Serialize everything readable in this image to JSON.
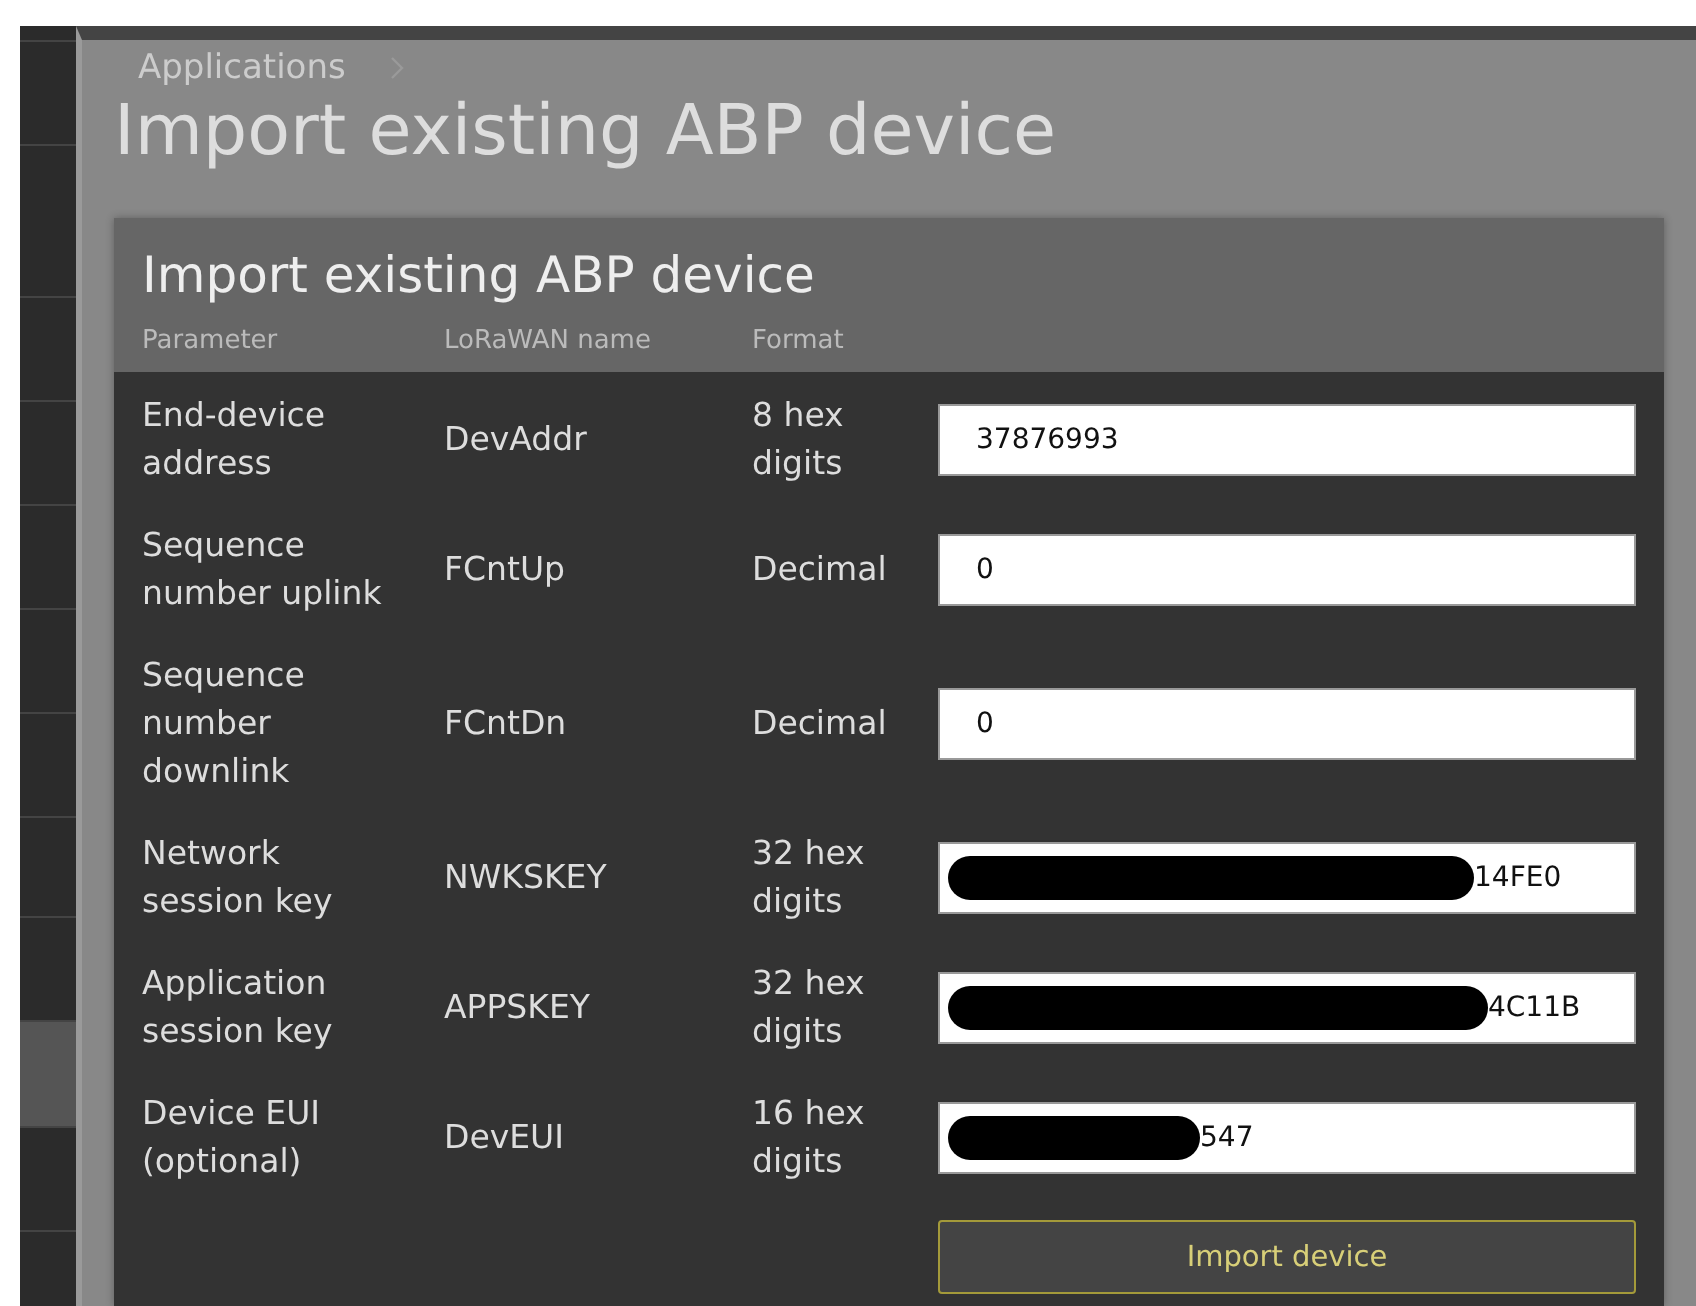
{
  "sidebar": {
    "items": [
      {
        "selected": false
      },
      {
        "selected": false
      },
      {
        "selected": false
      },
      {
        "selected": false
      },
      {
        "selected": false
      },
      {
        "selected": false
      },
      {
        "selected": false
      },
      {
        "selected": false
      },
      {
        "selected": false
      },
      {
        "selected": true
      },
      {
        "selected": false
      },
      {
        "selected": false
      }
    ]
  },
  "breadcrumb": [
    "Applications"
  ],
  "page_title": "Import existing ABP device",
  "card": {
    "title": "Import existing ABP device",
    "columns": [
      "Parameter",
      "LoRaWAN name",
      "Format"
    ],
    "rows": [
      {
        "parameter": "End-device address",
        "name": "DevAddr",
        "format": "8 hex digits",
        "value": "37876993",
        "redacted": false
      },
      {
        "parameter": "Sequence number uplink",
        "name": "FCntUp",
        "format": "Decimal",
        "value": "0",
        "redacted": false
      },
      {
        "parameter": "Sequence number downlink",
        "name": "FCntDn",
        "format": "Decimal",
        "value": "0",
        "redacted": false
      },
      {
        "parameter": "Network session key",
        "name": "NWKSKEY",
        "format": "32 hex digits",
        "value": "14FE0",
        "redacted": true
      },
      {
        "parameter": "Application session key",
        "name": "APPSKEY",
        "format": "32 hex digits",
        "value": "4C11B",
        "redacted": true
      },
      {
        "parameter": "Device EUI (optional)",
        "name": "DevEUI",
        "format": "16 hex digits",
        "value": "547",
        "redacted": true
      }
    ],
    "button": "Import device"
  }
}
